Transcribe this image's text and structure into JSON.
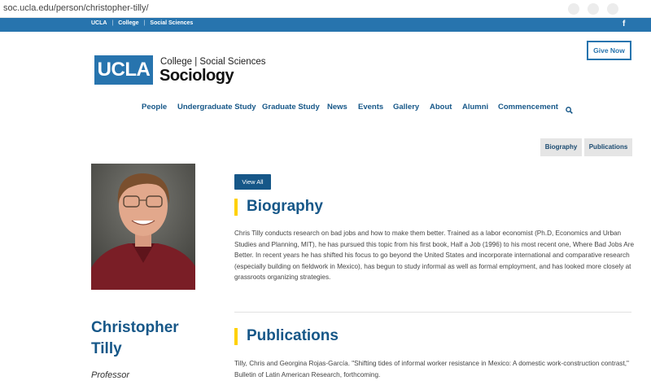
{
  "browser": {
    "url": "soc.ucla.edu/person/christopher-tilly/"
  },
  "topbar": {
    "links": [
      "UCLA",
      "College",
      "Social Sciences"
    ],
    "social_icon": "f"
  },
  "logo": {
    "mark": "UCLA",
    "line1": "College | Social Sciences",
    "line2": "Sociology"
  },
  "give_button": "Give Now",
  "nav": {
    "items": [
      "People",
      "Undergraduate Study",
      "Graduate Study",
      "News",
      "Events",
      "Gallery",
      "About",
      "Alumni",
      "Commencement"
    ],
    "search_icon": "search-icon"
  },
  "tabs": [
    "Biography",
    "Publications"
  ],
  "profile": {
    "photo_icon": "portrait-photo",
    "first_name": "Christopher",
    "last_name": "Tilly",
    "title": "Professor"
  },
  "view_all": "View All",
  "biography": {
    "heading": "Biography",
    "text": "Chris Tilly conducts research on bad jobs and how to make them better.  Trained as a labor economist (Ph.D, Economics and Urban Studies and Planning, MIT), he has pursued this topic from his first book, Half a Job (1996) to his most recent one, Where Bad Jobs Are Better.  In recent years he has shifted his focus to go beyond the United States and incorporate international and comparative research (especially building on fieldwork in Mexico), has begun to study informal as well as formal employment, and has looked more closely at grassroots organizing strategies."
  },
  "publications": {
    "heading": "Publications",
    "first_entry": "Tilly, Chris and Georgina Rojas-García.  \"Shifting tides of informal worker resistance in Mexico: A domestic work-construction contrast,\" Bulletin of Latin American Research, forthcoming."
  },
  "colors": {
    "ucla_blue": "#2774ae",
    "dark_blue": "#165788",
    "gold": "#ffd100",
    "tab_bg": "#e5e5e5"
  }
}
